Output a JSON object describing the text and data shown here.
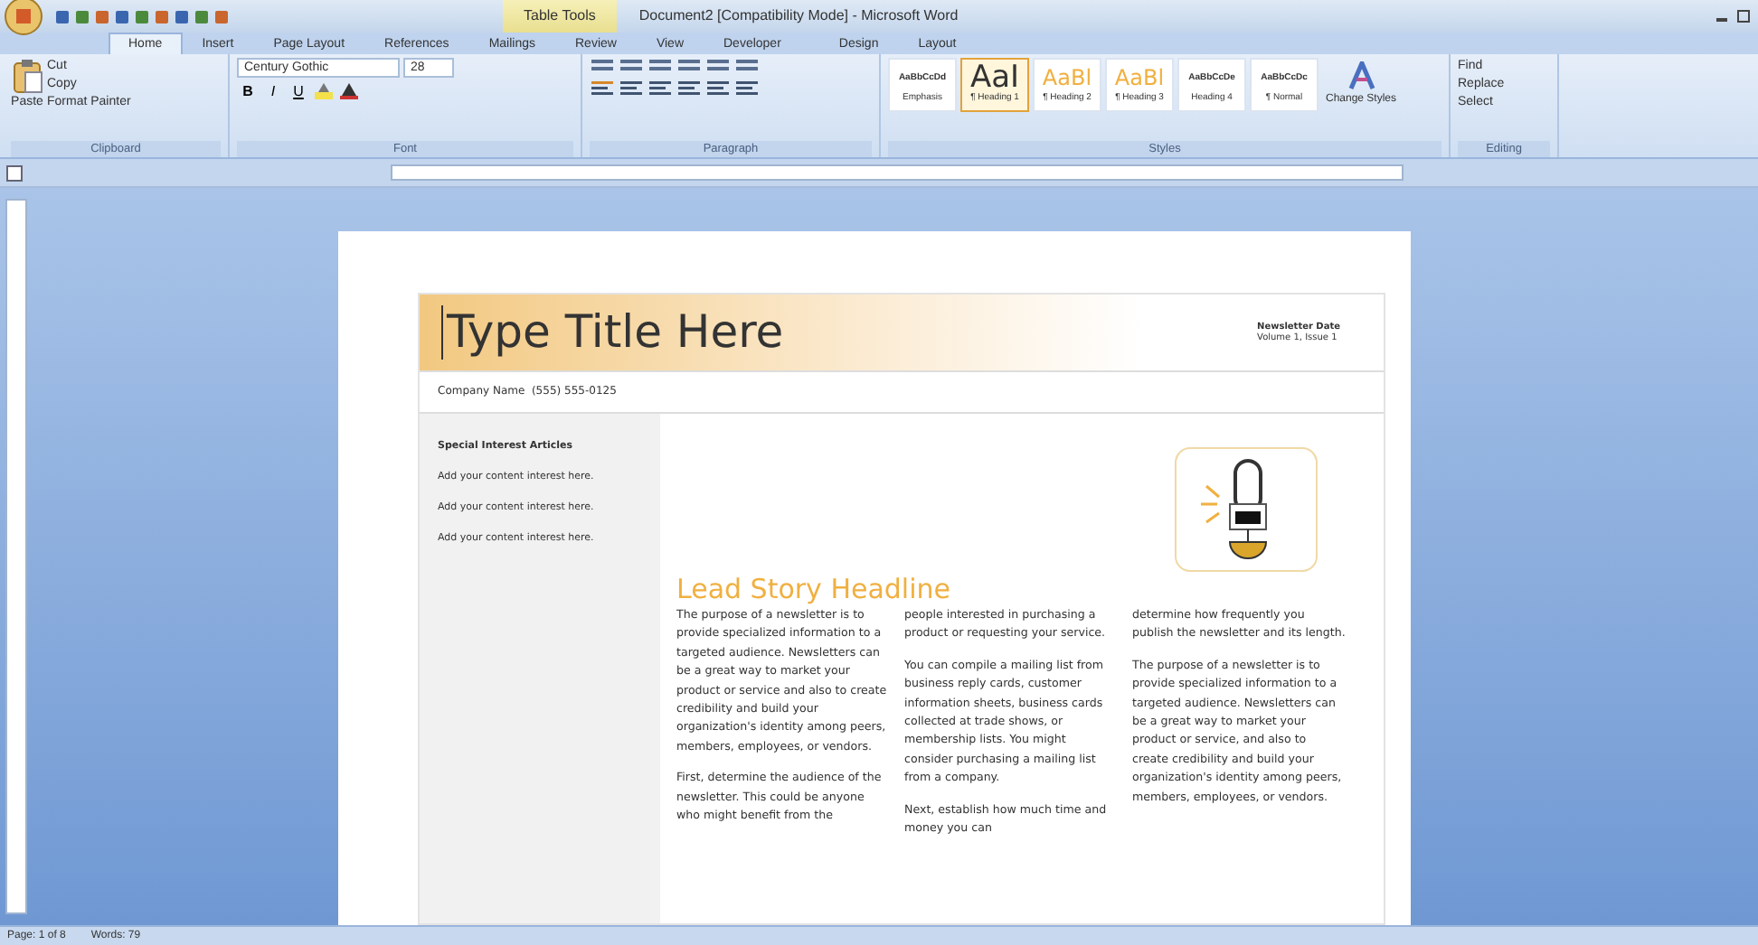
{
  "window": {
    "title": "Document2 [Compatibility Mode] - Microsoft Word",
    "contextual_tab": "Table Tools"
  },
  "tabs": [
    {
      "label": "Home",
      "selected": true
    },
    {
      "label": "Insert",
      "selected": false
    },
    {
      "label": "Page Layout",
      "selected": false
    },
    {
      "label": "References",
      "selected": false
    },
    {
      "label": "Mailings",
      "selected": false
    },
    {
      "label": "Review",
      "selected": false
    },
    {
      "label": "View",
      "selected": false
    },
    {
      "label": "Developer",
      "selected": false
    },
    {
      "label": "Design",
      "selected": false
    },
    {
      "label": "Layout",
      "selected": false
    }
  ],
  "clipboard": {
    "paste": "Paste",
    "items": [
      "Cut",
      "Copy",
      "Format Painter"
    ],
    "label": "Clipboard"
  },
  "font": {
    "name": "Century Gothic",
    "size": "28",
    "format_buttons": [
      "B",
      "I",
      "U"
    ],
    "label": "Font"
  },
  "paragraph": {
    "label": "Paragraph"
  },
  "styles": {
    "label": "Styles",
    "items": [
      {
        "preview": "AaBbCcDd",
        "name": "Emphasis",
        "selected": false,
        "kind": "small"
      },
      {
        "preview": "AaI",
        "name": "¶ Heading 1",
        "selected": true,
        "kind": "big"
      },
      {
        "preview": "AaBl",
        "name": "¶ Heading 2",
        "selected": false,
        "kind": "orange"
      },
      {
        "preview": "AaBl",
        "name": "¶ Heading 3",
        "selected": false,
        "kind": "orange"
      },
      {
        "preview": "AaBbCcDe",
        "name": "Heading 4",
        "selected": false,
        "kind": "small"
      },
      {
        "preview": "AaBbCcDc",
        "name": "¶ Normal",
        "selected": false,
        "kind": "small"
      }
    ]
  },
  "change_styles": "Change Styles",
  "editing": {
    "items": [
      "Find",
      "Replace",
      "Select"
    ],
    "label": "Editing"
  },
  "document": {
    "title": "Type Title Here",
    "newsletter_date": "Newsletter Date",
    "volume": "Volume 1, Issue 1",
    "company": "Company Name  (555) 555-0125",
    "sidebar_heading": "Special Interest Articles",
    "sidebar_items": [
      "Add your content interest here.",
      "Add your content interest here.",
      "Add your content interest here."
    ],
    "headline": "Lead Story Headline",
    "columns": [
      [
        "The purpose of a newsletter is to provide specialized information to a targeted audience. Newsletters can be a great way to market your product or service and also to create credibility and build your organization's identity among peers, members, employees, or vendors.",
        "First, determine the audience of the newsletter. This could be anyone who might benefit from the"
      ],
      [
        "people interested in purchasing a product or requesting your service.",
        "You can compile a mailing list from business reply cards, customer information sheets, business cards collected at trade shows, or membership lists. You might consider purchasing a mailing list from a company.",
        "Next, establish how much time and money you can"
      ],
      [
        "determine how frequently you publish the newsletter and its length.",
        "The purpose of a newsletter is to provide specialized information to a targeted audience. Newsletters can be a great way to market your product or service, and also to create credibility and build your organization's identity among peers, members, employees, or vendors."
      ]
    ]
  },
  "status_bar": [
    "Page: 1 of 8",
    "Words: 79"
  ]
}
